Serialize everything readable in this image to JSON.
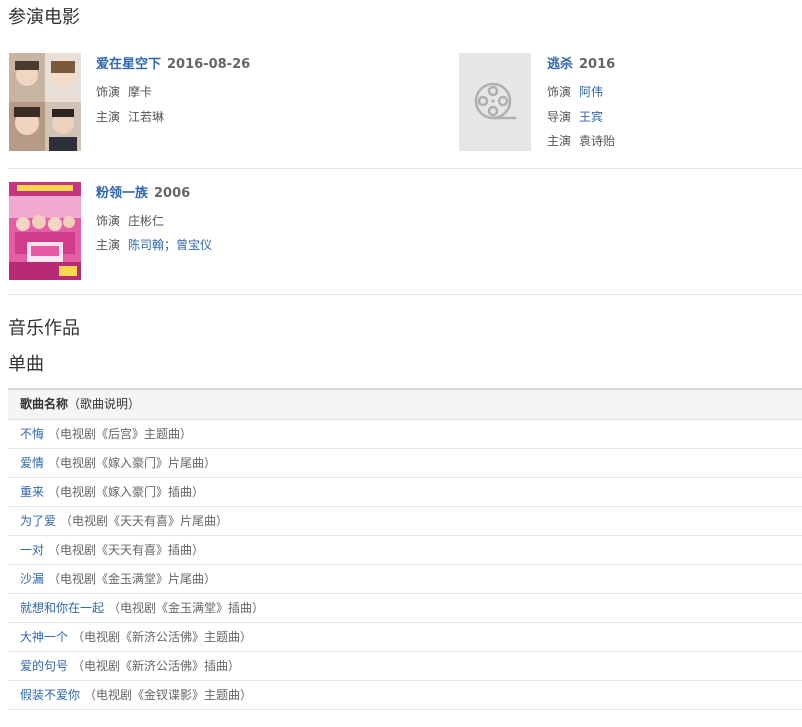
{
  "sections": {
    "films_heading": "参演电影",
    "music_heading": "音乐作品",
    "singles_heading": "单曲"
  },
  "films": [
    {
      "title": "爱在星空下",
      "year": "2016-08-26",
      "rows": [
        {
          "label": "饰演",
          "value": "摩卡",
          "links": []
        },
        {
          "label": "主演",
          "value": "江若琳",
          "links": []
        }
      ]
    },
    {
      "title": "逃杀",
      "year": "2016",
      "rows": [
        {
          "label": "饰演",
          "value": "",
          "links": [
            "阿伟"
          ]
        },
        {
          "label": "导演",
          "value": "",
          "links": [
            "王宾"
          ]
        },
        {
          "label": "主演",
          "value": "袁诗贻",
          "links": []
        }
      ]
    },
    {
      "title": "粉领一族",
      "year": "2006",
      "rows": [
        {
          "label": "饰演",
          "value": "庄彬仁",
          "links": []
        },
        {
          "label": "主演",
          "value": "",
          "links": [
            "陈司翰",
            "曾宝仪"
          ]
        }
      ]
    }
  ],
  "songs_table": {
    "header_name": "歌曲名称",
    "header_desc": "（歌曲说明）",
    "rows": [
      {
        "name": "不悔",
        "desc": "（电视剧《后宫》主题曲）"
      },
      {
        "name": "爱情",
        "desc": "（电视剧《嫁入豪门》片尾曲）"
      },
      {
        "name": "重来",
        "desc": "（电视剧《嫁入豪门》插曲）"
      },
      {
        "name": "为了爱",
        "desc": "（电视剧《天天有喜》片尾曲）"
      },
      {
        "name": "一对",
        "desc": "（电视剧《天天有喜》插曲）"
      },
      {
        "name": "沙漏",
        "desc": "（电视剧《金玉满堂》片尾曲）"
      },
      {
        "name": "就想和你在一起",
        "desc": "（电视剧《金玉满堂》插曲）"
      },
      {
        "name": "大神一个",
        "desc": "（电视剧《新济公活佛》主题曲）"
      },
      {
        "name": "爱的句号",
        "desc": "（电视剧《新济公活佛》插曲）"
      },
      {
        "name": "假装不爱你",
        "desc": "（电视剧《金钗谍影》主题曲）"
      }
    ]
  },
  "icons": {
    "poster_placeholder": "film-reel-icon"
  },
  "colors": {
    "link": "#2f66b1",
    "text": "#333333",
    "muted": "#666666"
  }
}
